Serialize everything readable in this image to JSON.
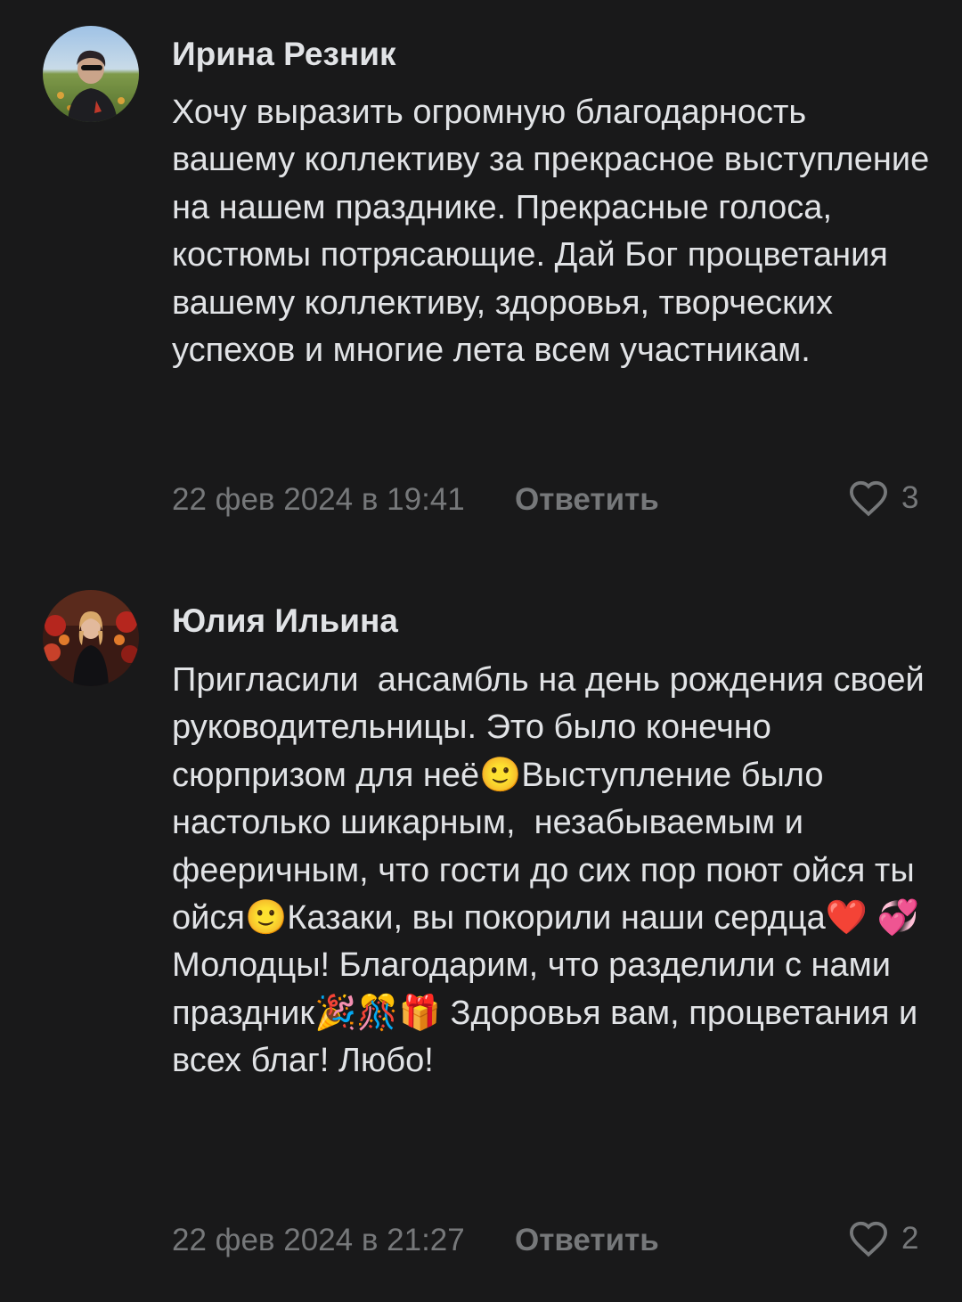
{
  "comments": [
    {
      "author": "Ирина Резник",
      "text": "Хочу выразить огромную благодарность вашему коллективу за прекрасное выступление на нашем празднике. Прекрасные голоса, костюмы потрясающие. Дай Бог процветания вашему коллективу, здоровья, творческих успехов и многие лета всем участникам.",
      "date": "22 фев 2024 в 19:41",
      "reply_label": "Ответить",
      "likes": "3",
      "like_icon": "heart-outline-icon"
    },
    {
      "author": "Юлия Ильина",
      "text": "Пригласили  ансамбль на день рождения своей руководительницы. Это было конечно сюрпризом для неё🙂Выступление было настолько шикарным,  незабываемым и фееричным, что гости до сих пор поют ойся ты ойся🙂Казаки, вы покорили наши сердца❤️ 💞  Молодцы! Благодарим, что разделили с нами праздник🎉🎊🎁 Здоровья вам, процветания и всех благ! Любо!",
      "date": "22 фев 2024 в 21:27",
      "reply_label": "Ответить",
      "likes": "2",
      "like_icon": "heart-outline-icon"
    }
  ],
  "colors": {
    "background": "#19191a",
    "text_primary": "#e1e3e6",
    "text_secondary": "#76787a"
  }
}
